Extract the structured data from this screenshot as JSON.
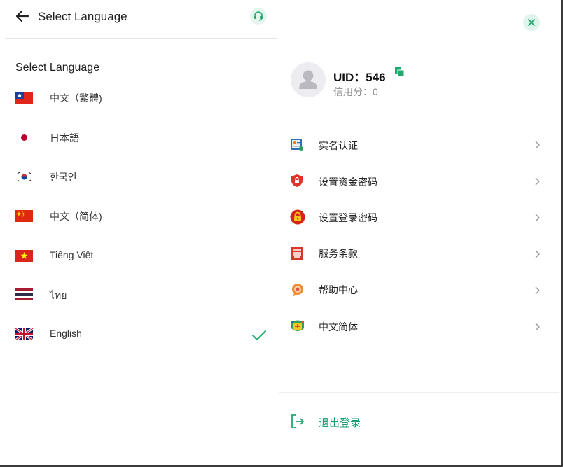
{
  "colors": {
    "accent": "#21a870",
    "accent_bg": "#e5f6ee",
    "muted": "#8a8a8a"
  },
  "left": {
    "title": "Select Language",
    "section_label": "Select Language",
    "languages": [
      {
        "label": "中文（繁體)",
        "flag": "taiwan-flag-icon",
        "selected": false
      },
      {
        "label": "日本語",
        "flag": "japan-flag-icon",
        "selected": false
      },
      {
        "label": "한국인",
        "flag": "korea-flag-icon",
        "selected": false
      },
      {
        "label": "中文（简体)",
        "flag": "china-flag-icon",
        "selected": false
      },
      {
        "label": "Tiếng Việt",
        "flag": "vietnam-flag-icon",
        "selected": false
      },
      {
        "label": "ไทย",
        "flag": "thailand-flag-icon",
        "selected": false
      },
      {
        "label": "English",
        "flag": "uk-flag-icon",
        "selected": true
      }
    ]
  },
  "right": {
    "uid": "UID：546",
    "credit": "信用分：0",
    "menu": [
      {
        "label": "实名认证",
        "icon": "id-card-icon"
      },
      {
        "label": "设置资金密码",
        "icon": "shield-lock-icon"
      },
      {
        "label": "设置登录密码",
        "icon": "padlock-icon"
      },
      {
        "label": "服务条款",
        "icon": "terms-document-icon"
      },
      {
        "label": "帮助中心",
        "icon": "help-chat-icon"
      },
      {
        "label": "中文简体",
        "icon": "language-icon"
      }
    ],
    "logout": "退出登录"
  }
}
